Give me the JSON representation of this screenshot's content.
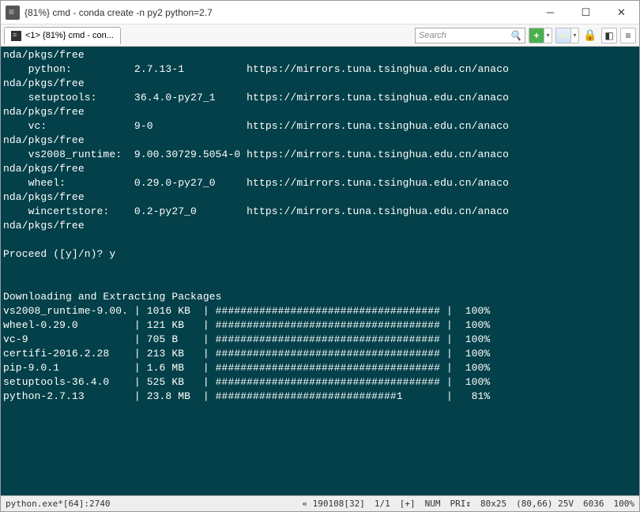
{
  "titlebar": {
    "title": "{81%} cmd - conda  create -n py2 python=2.7"
  },
  "tab": {
    "label": "<1> {81%} cmd - con..."
  },
  "toolbar": {
    "search_placeholder": "Search",
    "plus": "+"
  },
  "terminal": {
    "mirror": "https://mirrors.tuna.tsinghua.edu.cn/anaco",
    "repo": "nda/pkgs/free",
    "pkgs": [
      {
        "name": "python:",
        "ver": "2.7.13-1"
      },
      {
        "name": "setuptools:",
        "ver": "36.4.0-py27_1"
      },
      {
        "name": "vc:",
        "ver": "9-0"
      },
      {
        "name": "vs2008_runtime:",
        "ver": "9.00.30729.5054-0"
      },
      {
        "name": "wheel:",
        "ver": "0.29.0-py27_0"
      },
      {
        "name": "wincertstore:",
        "ver": "0.2-py27_0"
      }
    ],
    "proceed": "Proceed ([y]/n)? y",
    "dl_header": "Downloading and Extracting Packages",
    "downloads": [
      {
        "pkg": "vs2008_runtime-9.00.",
        "size": "1016 KB",
        "bar": "####################################",
        "pct": "100%"
      },
      {
        "pkg": "wheel-0.29.0",
        "size": "121 KB",
        "bar": "####################################",
        "pct": "100%"
      },
      {
        "pkg": "vc-9",
        "size": "705 B",
        "bar": "####################################",
        "pct": "100%"
      },
      {
        "pkg": "certifi-2016.2.28",
        "size": "213 KB",
        "bar": "####################################",
        "pct": "100%"
      },
      {
        "pkg": "pip-9.0.1",
        "size": "1.6 MB",
        "bar": "####################################",
        "pct": "100%"
      },
      {
        "pkg": "setuptools-36.4.0",
        "size": "525 KB",
        "bar": "####################################",
        "pct": "100%"
      },
      {
        "pkg": "python-2.7.13",
        "size": "23.8 MB",
        "bar": "#############################1      ",
        "pct": "81%"
      }
    ]
  },
  "status": {
    "left": "python.exe*[64]:2740",
    "mid1": "« 190108[32]",
    "mid2": "1/1",
    "mid3": "[+]",
    "mid4": "NUM",
    "mid5": "PRI↕",
    "mid6": "80x25",
    "mid7": "(80,66) 25V",
    "mid8": "6036",
    "mid9": "100%"
  }
}
